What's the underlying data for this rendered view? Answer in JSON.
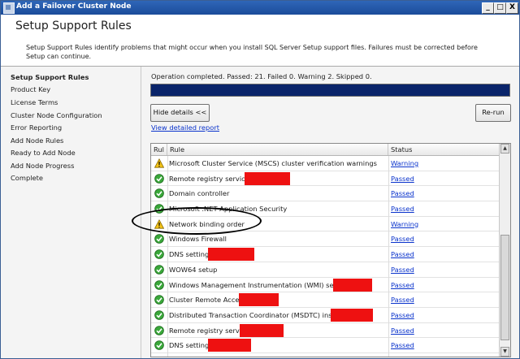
{
  "window": {
    "title": "Add a Failover Cluster Node",
    "controls": [
      "_",
      "□",
      "X"
    ]
  },
  "header": {
    "title": "Setup Support Rules",
    "description": "Setup Support Rules identify problems that might occur when you install SQL Server Setup support files. Failures must be corrected before Setup can continue."
  },
  "nav": {
    "items": [
      {
        "label": "Setup Support Rules",
        "active": true
      },
      {
        "label": "Product Key"
      },
      {
        "label": "License Terms"
      },
      {
        "label": "Cluster Node Configuration"
      },
      {
        "label": "Error Reporting"
      },
      {
        "label": "Add Node Rules"
      },
      {
        "label": "Ready to Add Node"
      },
      {
        "label": "Add Node Progress"
      },
      {
        "label": "Complete"
      }
    ]
  },
  "main": {
    "status": "Operation completed. Passed: 21.   Failed 0.   Warning 2.   Skipped 0.",
    "progress_value": 1.0,
    "hide_details_label": "Hide details <<",
    "rerun_label": "Re-run",
    "view_report_label": "View detailed report"
  },
  "grid": {
    "columns": [
      "Rul",
      "Rule",
      "Status"
    ],
    "rows": [
      {
        "icon": "warning-icon",
        "rule": "Microsoft Cluster Service (MSCS) cluster verification warnings",
        "status": "Warning"
      },
      {
        "icon": "passed-icon",
        "rule": "Remote registry service",
        "status": "Passed"
      },
      {
        "icon": "passed-icon",
        "rule": "Domain controller",
        "status": "Passed"
      },
      {
        "icon": "passed-icon",
        "rule": "Microsoft .NET Application Security",
        "status": "Passed"
      },
      {
        "icon": "warning-icon",
        "rule": "Network binding order",
        "status": "Warning"
      },
      {
        "icon": "passed-icon",
        "rule": "Windows Firewall",
        "status": "Passed"
      },
      {
        "icon": "passed-icon",
        "rule": "DNS settings",
        "status": "Passed"
      },
      {
        "icon": "passed-icon",
        "rule": "WOW64 setup",
        "status": "Passed"
      },
      {
        "icon": "passed-icon",
        "rule": "Windows Management Instrumentation (WMI) service",
        "status": "Passed"
      },
      {
        "icon": "passed-icon",
        "rule": "Cluster Remote Access",
        "status": "Passed"
      },
      {
        "icon": "passed-icon",
        "rule": "Distributed Transaction Coordinator (MSDTC) installed",
        "status": "Passed"
      },
      {
        "icon": "passed-icon",
        "rule": "Remote registry service",
        "status": "Passed"
      },
      {
        "icon": "passed-icon",
        "rule": "DNS settings",
        "status": "Passed"
      }
    ]
  },
  "colors": {
    "title_bar": "#1b4c9a",
    "progress_fill": "#0a246a",
    "link": "#0a33cc",
    "redaction": "#ee1111"
  }
}
